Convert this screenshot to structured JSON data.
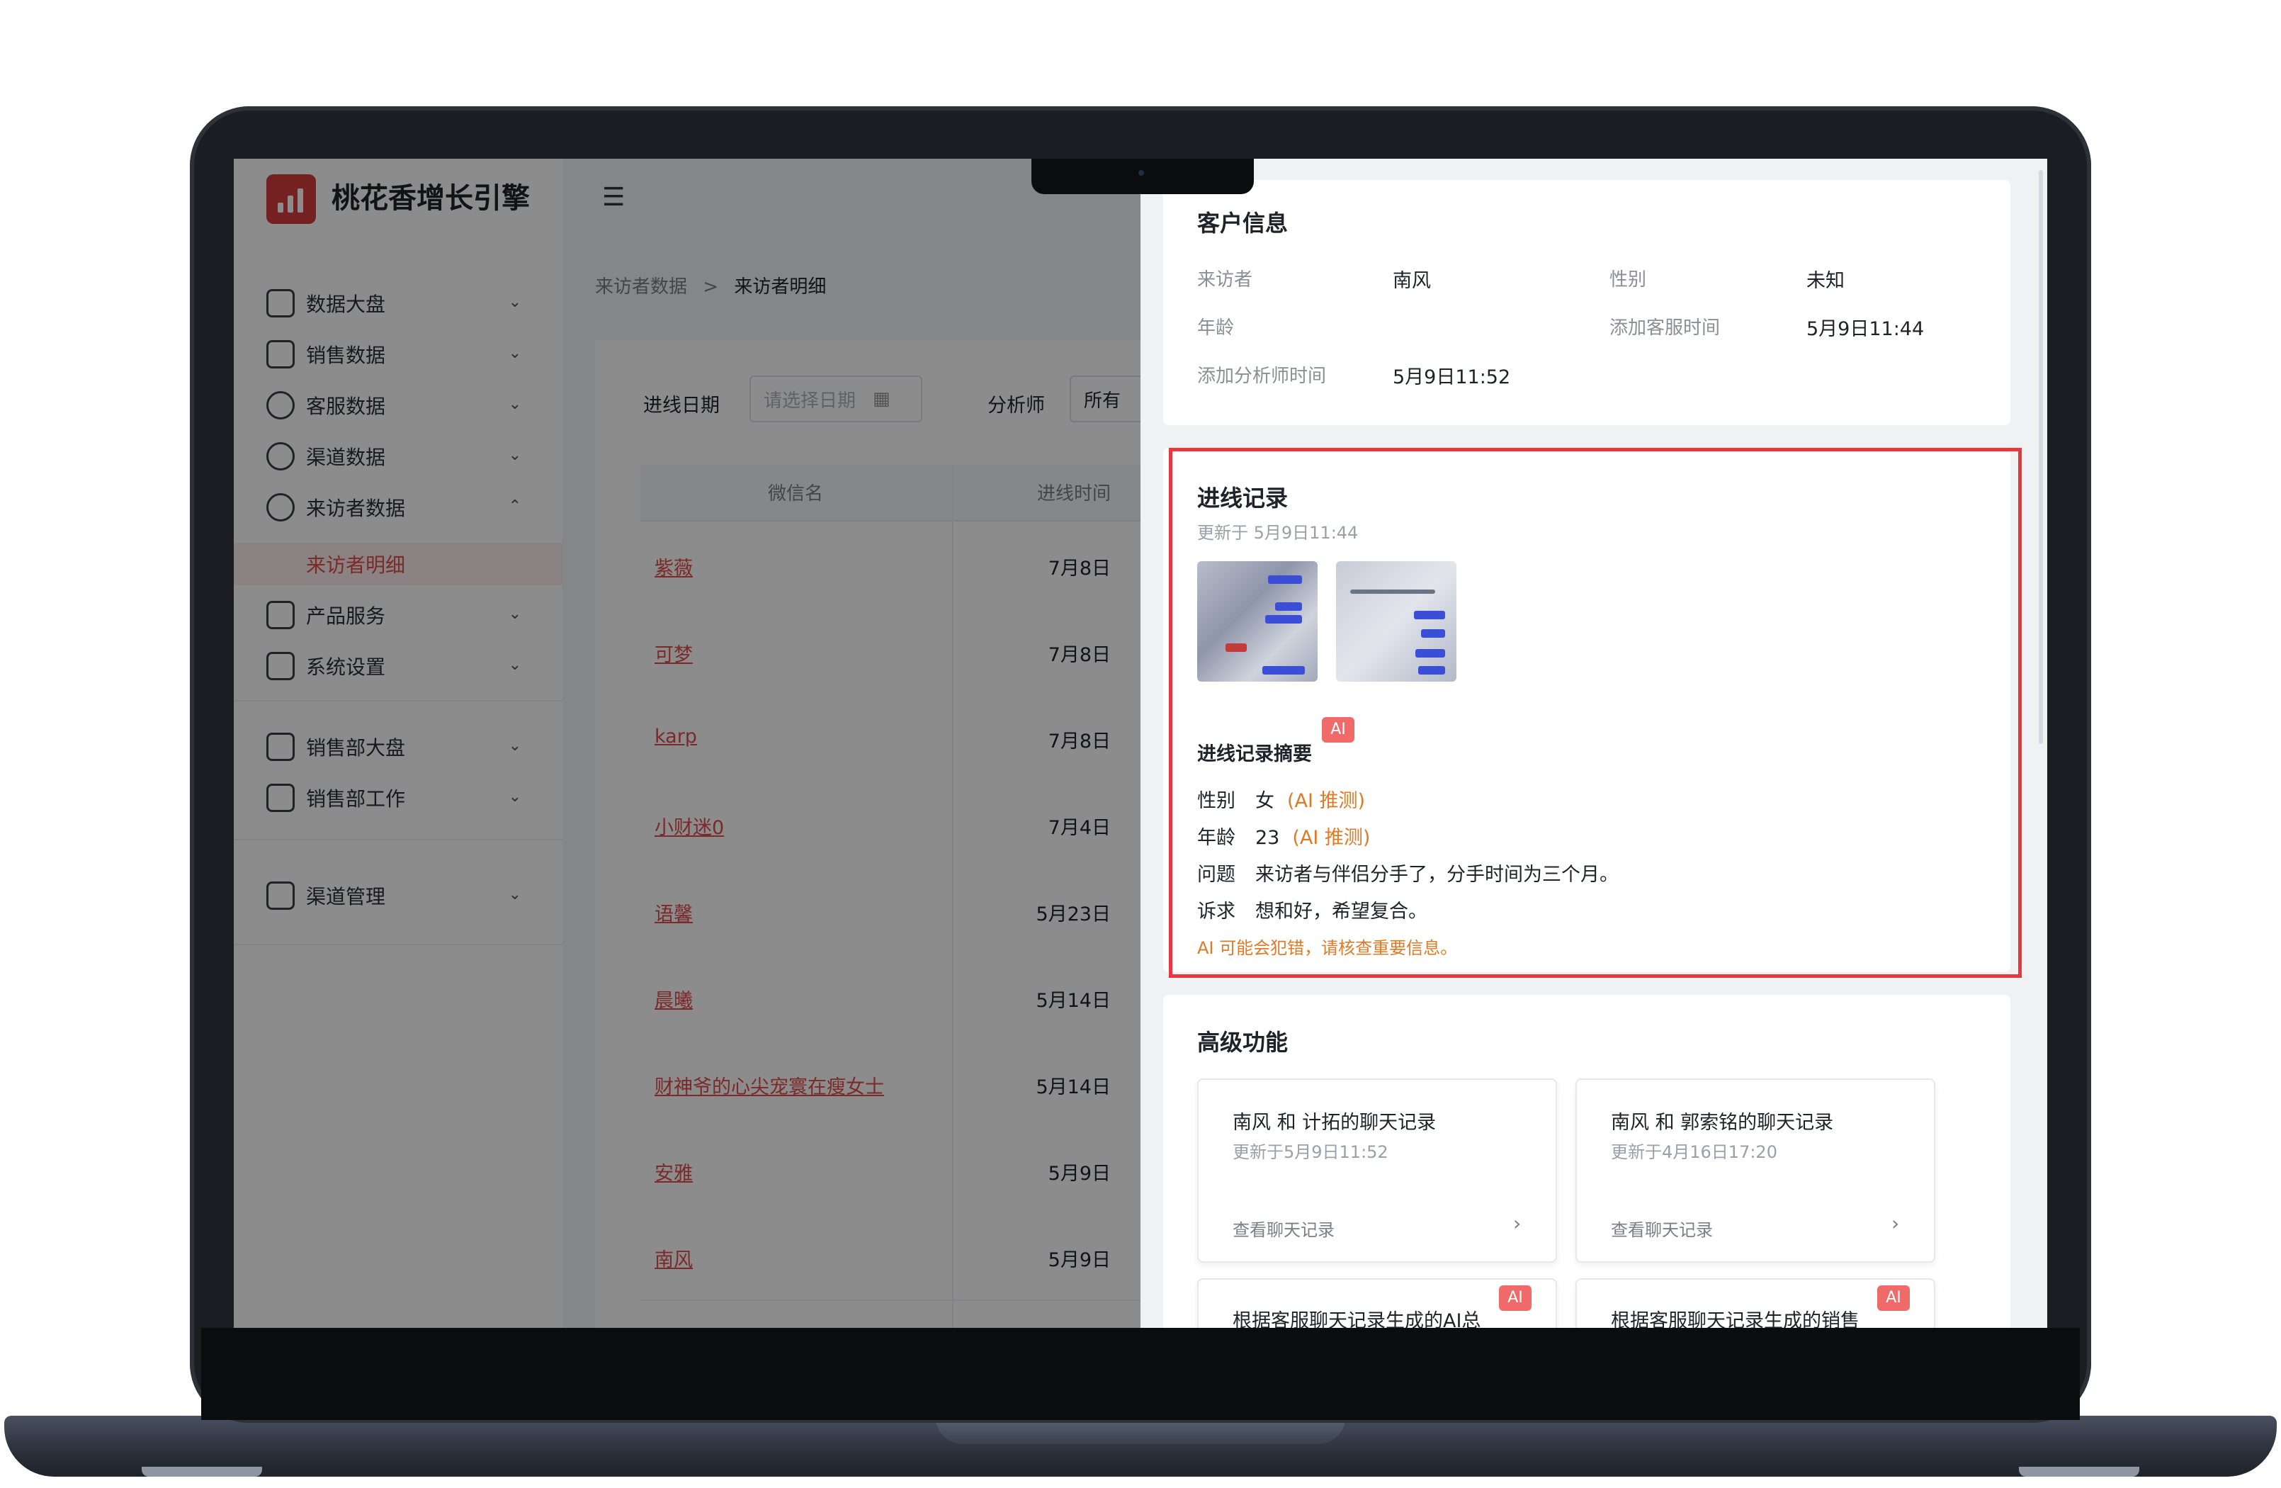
{
  "app": {
    "brand": "桃花香增长引擎",
    "menu_icon": "menu-icon",
    "nav": [
      {
        "label": "数据大盘",
        "icon": "line-chart-icon",
        "expanded": false
      },
      {
        "label": "销售数据",
        "icon": "handshake-icon",
        "expanded": false
      },
      {
        "label": "客服数据",
        "icon": "user-icon",
        "expanded": false
      },
      {
        "label": "渠道数据",
        "icon": "users-icon",
        "expanded": false
      },
      {
        "label": "来访者数据",
        "icon": "visitor-icon",
        "expanded": true
      },
      {
        "label": "来访者明细",
        "active": true
      },
      {
        "label": "产品服务",
        "icon": "command-icon",
        "expanded": false
      },
      {
        "label": "系统设置",
        "icon": "sliders-icon",
        "expanded": false
      },
      {
        "label": "销售部大盘",
        "icon": "line-chart-icon",
        "expanded": false
      },
      {
        "label": "销售部工作",
        "icon": "handshake-icon",
        "expanded": false
      },
      {
        "label": "渠道管理",
        "icon": "image-icon",
        "expanded": false
      }
    ],
    "breadcrumb": {
      "parent": "来访者数据",
      "separator": ">",
      "current": "来访者明细"
    },
    "filters": {
      "date_label": "进线日期",
      "date_placeholder": "请选择日期",
      "analyst_label": "分析师",
      "analyst_value": "所有"
    },
    "table": {
      "headers": [
        "微信名",
        "进线时间"
      ],
      "rows": [
        {
          "name": "紫薇",
          "time": "7月8日"
        },
        {
          "name": "可梦",
          "time": "7月8日"
        },
        {
          "name": "karp",
          "time": "7月8日"
        },
        {
          "name": "小财迷0",
          "time": "7月4日"
        },
        {
          "name": "语馨",
          "time": "5月23日"
        },
        {
          "name": "晨曦",
          "time": "5月14日"
        },
        {
          "name": "财神爷的心尖宠寰在瘦女士",
          "time": "5月14日"
        },
        {
          "name": "安雅",
          "time": "5月9日"
        },
        {
          "name": "南风",
          "time": "5月9日"
        }
      ]
    }
  },
  "drawer": {
    "customer_info": {
      "title": "客户信息",
      "visitor_label": "来访者",
      "visitor_value": "南风",
      "gender_label": "性别",
      "gender_value": "未知",
      "age_label": "年龄",
      "age_value": "",
      "cs_time_label": "添加客服时间",
      "cs_time_value": "5月9日11:44",
      "analyst_time_label": "添加分析师时间",
      "analyst_time_value": "5月9日11:52"
    },
    "intake": {
      "title": "进线记录",
      "updated": "更新于 5月9日11:44",
      "summary_title": "进线记录摘要",
      "ai_badge": "AI",
      "rows": [
        {
          "key": "性别",
          "value": "女",
          "note": "(AI 推测)"
        },
        {
          "key": "年龄",
          "value": "23",
          "note": "(AI 推测)"
        },
        {
          "key": "问题",
          "value": "来访者与伴侣分手了，分手时间为三个月。",
          "note": ""
        },
        {
          "key": "诉求",
          "value": "想和好，希望复合。",
          "note": ""
        }
      ],
      "warning": "AI 可能会犯错，请核查重要信息。"
    },
    "advanced": {
      "title": "高级功能",
      "cards": [
        {
          "title": "南风 和 计拓的聊天记录",
          "updated": "更新于5月9日11:52",
          "link": "查看聊天记录"
        },
        {
          "title": "南风 和 郭索铭的聊天记录",
          "updated": "更新于4月16日17:20",
          "link": "查看聊天记录"
        }
      ],
      "ai_cards": [
        {
          "title": "根据客服聊天记录生成的AI总",
          "badge": "AI"
        },
        {
          "title": "根据客服聊天记录生成的销售",
          "badge": "AI"
        }
      ]
    }
  },
  "colors": {
    "accent": "#e14b4b",
    "highlight_border": "#e8373f",
    "ai_note": "#e07a26",
    "badge": "#f06a6a"
  }
}
